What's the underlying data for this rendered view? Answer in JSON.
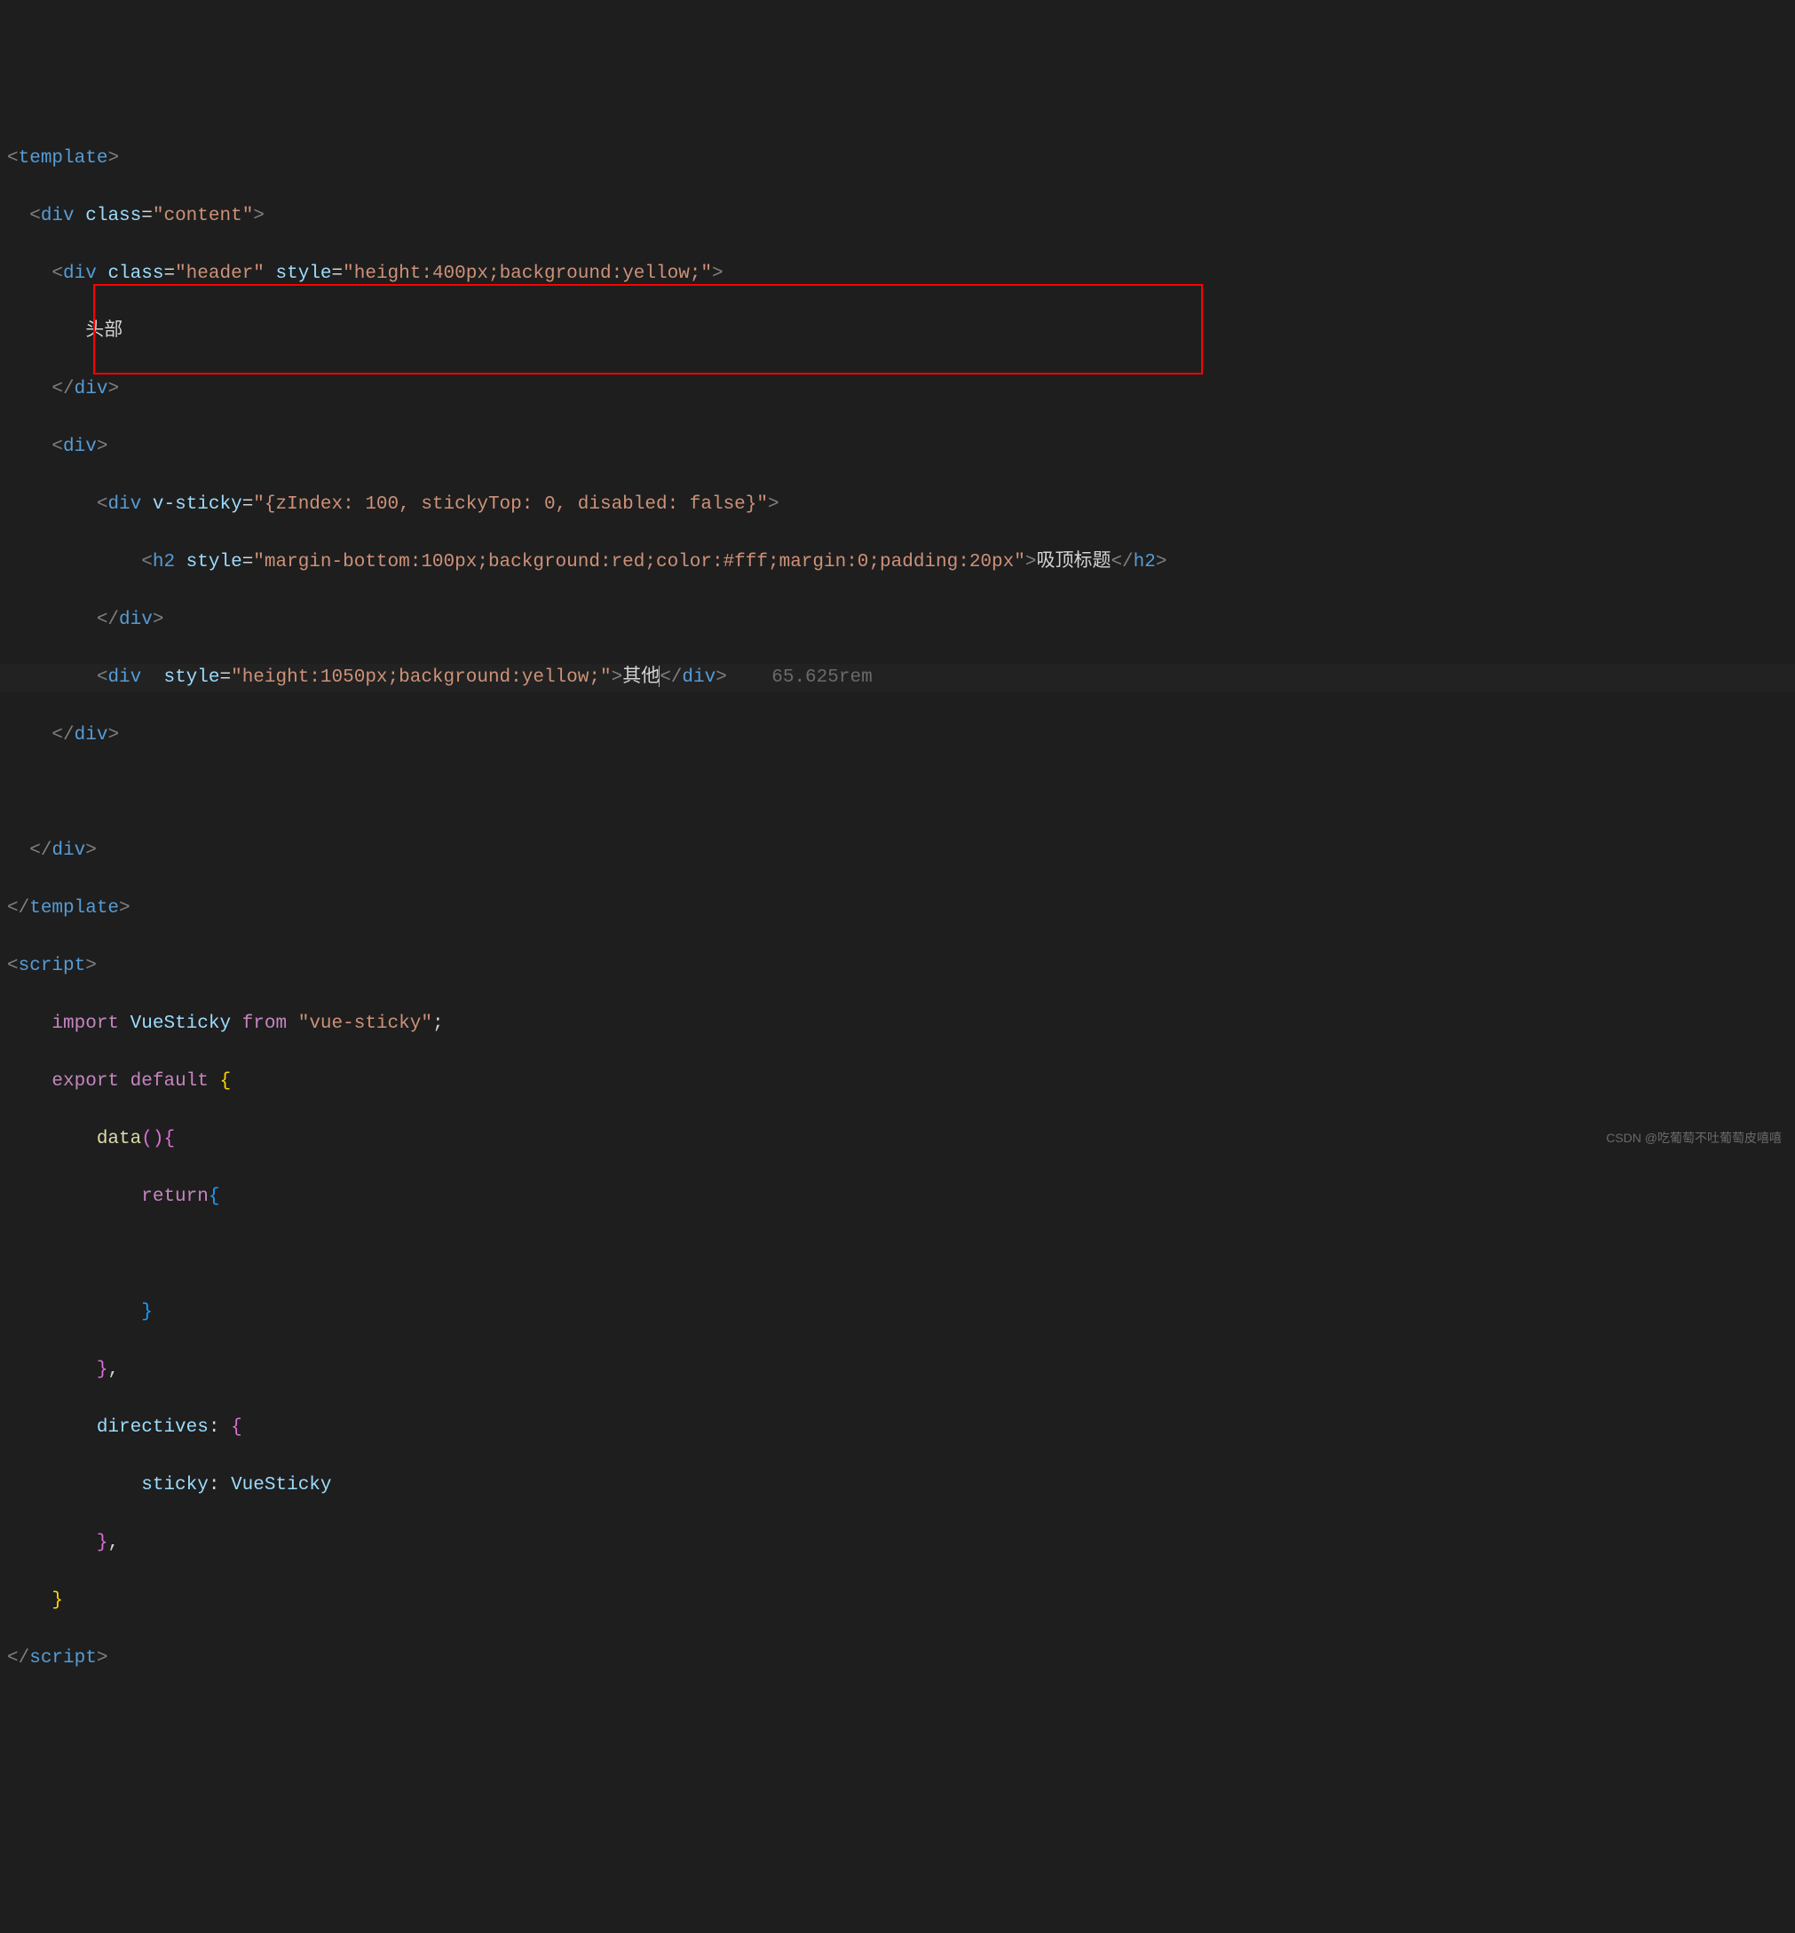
{
  "code": {
    "l1": {
      "open": "<",
      "tag": "template",
      "close": ">"
    },
    "l2": {
      "open": "<",
      "tag": "div",
      "attr": "class",
      "eq": "=",
      "val": "\"content\"",
      "close": ">"
    },
    "l3": {
      "open": "<",
      "tag": "div",
      "attr1": "class",
      "eq1": "=",
      "val1": "\"header\"",
      "attr2": "style",
      "eq2": "=",
      "val2": "\"height:400px;background:yellow;\"",
      "close": ">"
    },
    "l4": {
      "text": "头部"
    },
    "l5": {
      "open": "</",
      "tag": "div",
      "close": ">"
    },
    "l6": {
      "open": "<",
      "tag": "div",
      "close": ">"
    },
    "l7": {
      "open": "<",
      "tag": "div",
      "attr": "v-sticky",
      "eq": "=",
      "val": "\"{zIndex: 100, stickyTop: 0, disabled: false}\"",
      "close": ">"
    },
    "l8": {
      "open": "<",
      "tag": "h2",
      "attr": "style",
      "eq": "=",
      "val": "\"margin-bottom:100px;background:red;color:#fff;margin:0;padding:20px\"",
      "close": ">",
      "text": "吸顶标题",
      "open2": "</",
      "tag2": "h2",
      "close2": ">"
    },
    "l9": {
      "open": "</",
      "tag": "div",
      "close": ">"
    },
    "l10": {
      "open": "<",
      "tag": "div",
      "attr": "style",
      "eq": "=",
      "val": "\"height:1050px;background:yellow;\"",
      "close": ">",
      "text": "其他",
      "open2": "</",
      "tag2": "div",
      "close2": ">",
      "hint": "65.625rem"
    },
    "l11": {
      "open": "</",
      "tag": "div",
      "close": ">"
    },
    "l12": {
      "text": ""
    },
    "l13": {
      "open": "</",
      "tag": "div",
      "close": ">"
    },
    "l14": {
      "open": "</",
      "tag": "template",
      "close": ">"
    },
    "l15": {
      "open": "<",
      "tag": "script",
      "close": ">"
    },
    "l16": {
      "kw1": "import",
      "var": "VueSticky",
      "kw2": "from",
      "str": "\"vue-sticky\"",
      "semi": ";"
    },
    "l17": {
      "kw1": "export",
      "kw2": "default",
      "brace": "{"
    },
    "l18": {
      "fn": "data",
      "paren": "()",
      "brace": "{"
    },
    "l19": {
      "kw": "return",
      "brace": "{"
    },
    "l20": {
      "text": ""
    },
    "l21": {
      "brace": "}"
    },
    "l22": {
      "brace": "}",
      "comma": ","
    },
    "l23": {
      "prop": "directives",
      "colon": ":",
      "brace": "{"
    },
    "l24": {
      "prop": "sticky",
      "colon": ":",
      "var": "VueSticky"
    },
    "l25": {
      "brace": "}",
      "comma": ","
    },
    "l26": {
      "brace": "}"
    },
    "l27": {
      "open": "</",
      "tag": "script",
      "close": ">"
    }
  },
  "watermark": "CSDN @吃葡萄不吐葡萄皮嘻嘻"
}
